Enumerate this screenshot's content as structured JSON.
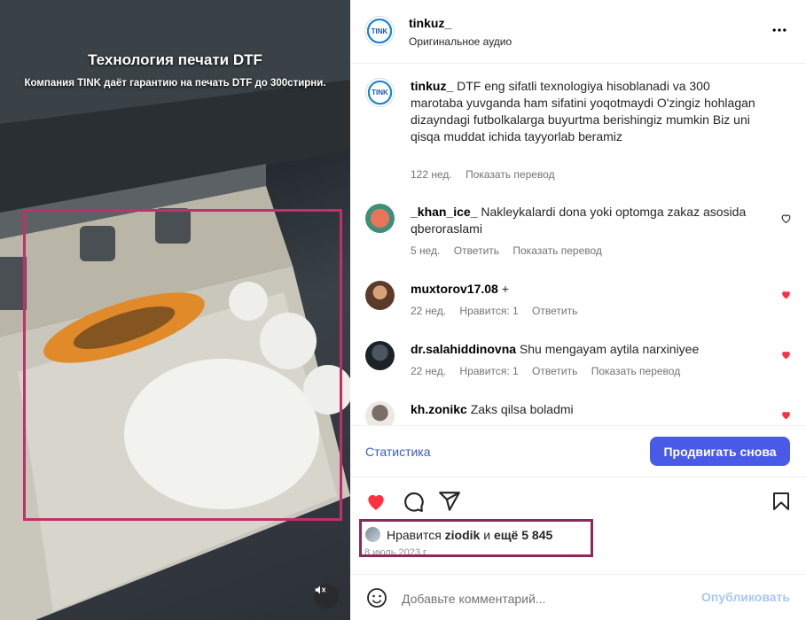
{
  "media": {
    "title": "Технология печати DTF",
    "subtitle": "Компания TINK даёт гарантию на печать DTF до 300стирни.",
    "mute_icon": "speaker-muted-icon"
  },
  "header": {
    "username": "tinkuz_",
    "audio": "Оригинальное аудио",
    "logo_text": "TINK",
    "more_icon": "more-horizontal-icon"
  },
  "caption": {
    "username": "tinkuz_",
    "text": "DTF eng sifatli texnologiya hisoblanadi va 300 marotaba yuvganda ham sifatini yoqotmaydi O'zingiz hohlagan dizayndagi futbolkalarga buyurtma berishingiz mumkin Biz uni qisqa muddat ichida tayyorlab beramiz",
    "time": "122 нед.",
    "translate": "Показать перевод"
  },
  "comments": [
    {
      "username": "_khan_ice_",
      "text": "Nakleykalardi dona yoki optomga zakaz asosida qberoraslami",
      "time": "5 нед.",
      "likes": "",
      "reply": "Ответить",
      "translate": "Показать перевод",
      "liked": false
    },
    {
      "username": "muxtorov17.08",
      "text": "+",
      "time": "22 нед.",
      "likes": "Нравится: 1",
      "reply": "Ответить",
      "translate": "",
      "liked": true
    },
    {
      "username": "dr.salahiddinovna",
      "text": "Shu mengayam aytila narxiniyee",
      "time": "22 нед.",
      "likes": "Нравится: 1",
      "reply": "Ответить",
      "translate": "Показать перевод",
      "liked": true
    },
    {
      "username": "kh.zonikc",
      "text": "Zaks qilsa boladmi",
      "time": "",
      "likes": "",
      "reply": "",
      "translate": "",
      "liked": true
    }
  ],
  "actions": {
    "stats_label": "Статистика",
    "promote_label": "Продвигать снова"
  },
  "likes": {
    "prefix": "Нравится",
    "user": "ziodik",
    "connector": "и",
    "others": "ещё 5 845",
    "date": "8 июль 2023 г."
  },
  "comment_box": {
    "placeholder": "Добавьте комментарий...",
    "post_label": "Опубликовать"
  },
  "colors": {
    "like_red": "#ff3040",
    "promote_blue": "#4a5ae8",
    "highlight": "#c2306c"
  }
}
